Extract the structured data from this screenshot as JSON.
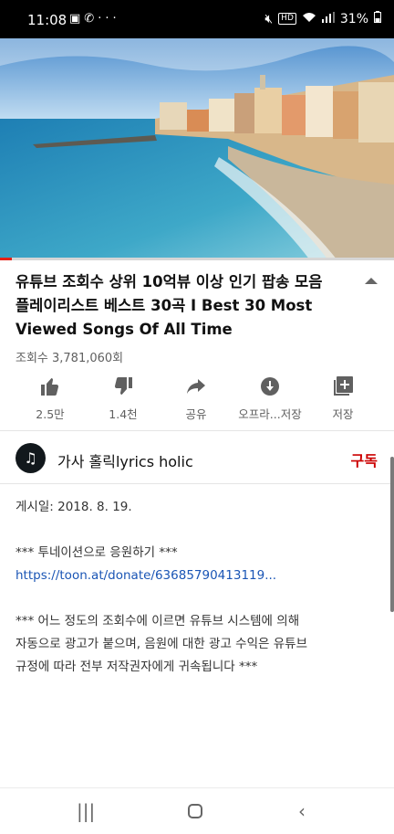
{
  "status_bar": {
    "time": "11:08",
    "left_icons": [
      "gallery-icon",
      "phone-icon",
      "more-dots-icon"
    ],
    "hd_label": "HD",
    "battery": "31%"
  },
  "video": {
    "progress_percent": 3
  },
  "title": "유튜브 조회수 상위 10억뷰 이상 인기 팝송 모음 플레이리스트 베스트 30곡 I Best 30 Most Viewed Songs Of All Time",
  "views": "조회수 3,781,060회",
  "actions": [
    {
      "icon": "thumbs-up-icon",
      "label": "2.5만"
    },
    {
      "icon": "thumbs-down-icon",
      "label": "1.4천"
    },
    {
      "icon": "share-icon",
      "label": "공유"
    },
    {
      "icon": "download-icon",
      "label": "오프라...저장"
    },
    {
      "icon": "add-to-playlist-icon",
      "label": "저장"
    }
  ],
  "channel": {
    "name": "가사 홀릭lyrics holic",
    "subscribe_label": "구독",
    "avatar_glyph": "♫"
  },
  "description": {
    "published": "게시일: 2018. 8. 19.",
    "donate_heading": "*** 투네이션으로 응원하기 ***",
    "donate_link": "https://toon.at/donate/63685790413119...",
    "notice_line1": "*** 어느 정도의 조회수에 이르면 유튜브 시스템에 의해",
    "notice_line2": "자동으로 광고가 붙으며, 음원에 대한 광고 수익은 유튜브",
    "notice_line3": "규정에 따라 전부 저작권자에게 귀속됩니다 ***"
  },
  "colors": {
    "accent_red": "#cc0000",
    "progress_red": "#e62117",
    "link_blue": "#1a55b5"
  }
}
